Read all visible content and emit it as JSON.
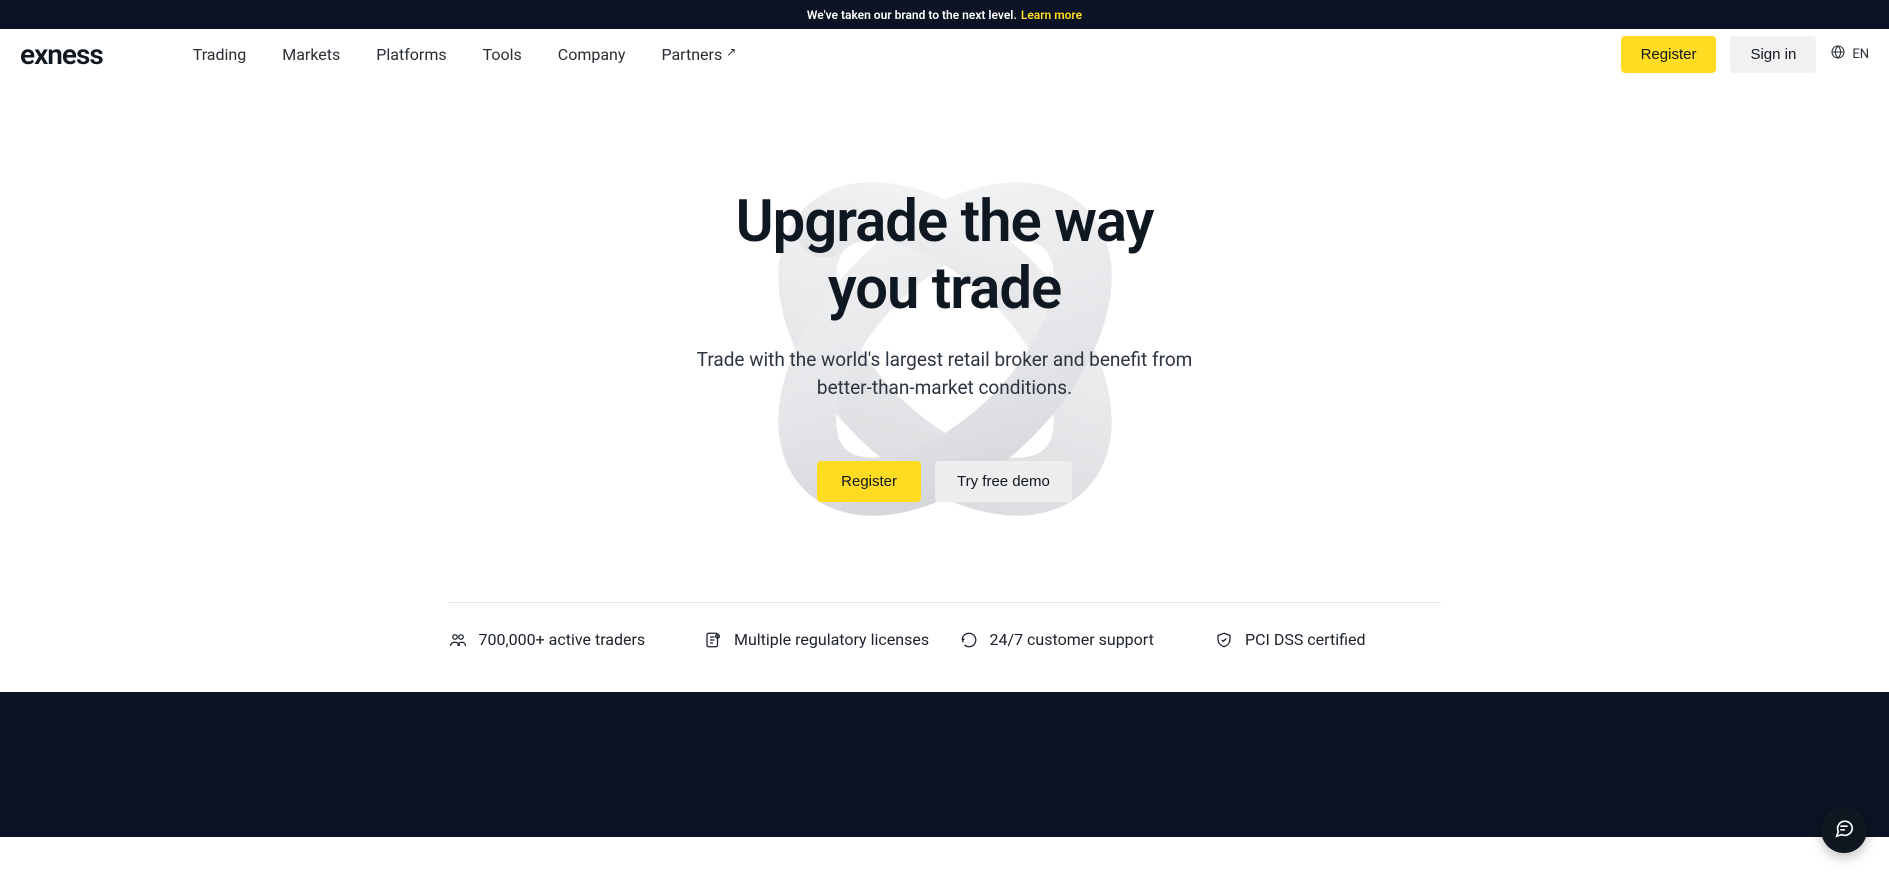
{
  "announcement": {
    "text": "We've taken our brand to the next level.",
    "link_label": "Learn more"
  },
  "brand": {
    "name": "exness"
  },
  "nav": {
    "items": [
      {
        "label": "Trading"
      },
      {
        "label": "Markets"
      },
      {
        "label": "Platforms"
      },
      {
        "label": "Tools"
      },
      {
        "label": "Company"
      },
      {
        "label": "Partners",
        "external": true
      }
    ],
    "register_label": "Register",
    "signin_label": "Sign in",
    "lang_code": "EN"
  },
  "hero": {
    "title_line1": "Upgrade the way",
    "title_line2": "you trade",
    "subtitle": "Trade with the world's largest retail broker and benefit from better-than-market conditions.",
    "cta_primary": "Register",
    "cta_secondary": "Try free demo"
  },
  "features": [
    {
      "icon": "users-icon",
      "label": "700,000+ active traders"
    },
    {
      "icon": "license-icon",
      "label": "Multiple regulatory licenses"
    },
    {
      "icon": "support-icon",
      "label": "24/7 customer support"
    },
    {
      "icon": "shield-icon",
      "label": "PCI DSS certified"
    }
  ]
}
